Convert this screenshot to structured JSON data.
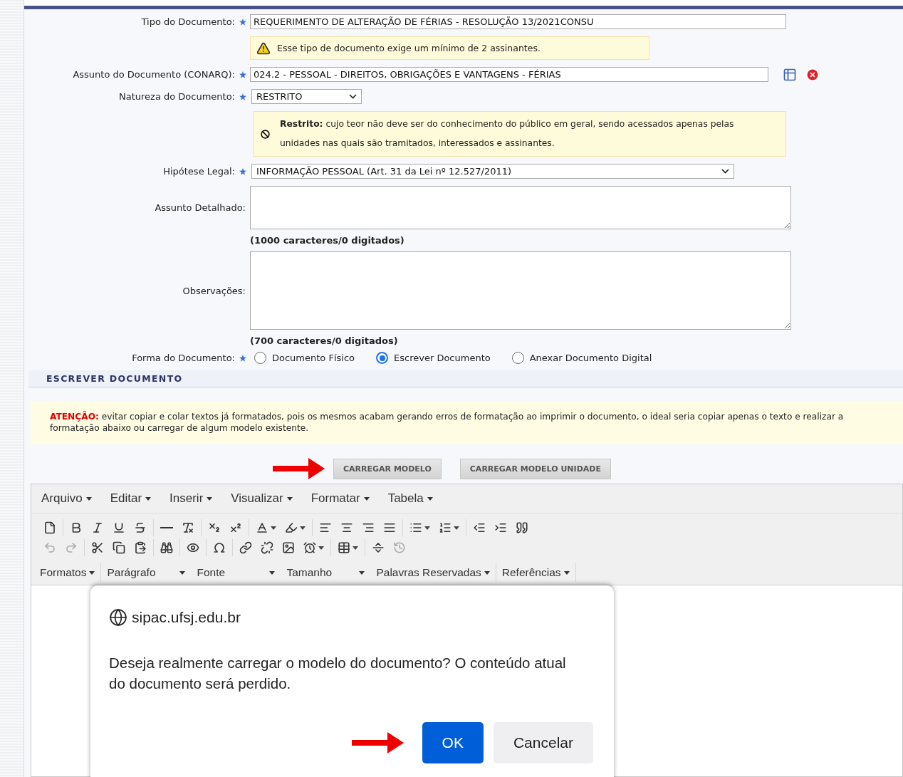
{
  "form": {
    "rows": [
      {
        "kind": "input",
        "label": "Tipo do Documento:",
        "required": true,
        "value": "REQUERIMENTO DE ALTERAÇÃO DE FÉRIAS - RESOLUÇÃO 13/2021CONSU"
      },
      {
        "kind": "warning",
        "text": "Esse tipo de documento exige um mínimo de 2 assinantes."
      },
      {
        "kind": "lookup",
        "label": "Assunto do Documento (CONARQ):",
        "required": true,
        "value": "024.2 - PESSOAL - DIREITOS, OBRIGAÇÕES E VANTAGENS - FÉRIAS"
      },
      {
        "kind": "select",
        "label": "Natureza do Documento:",
        "required": true,
        "value": "RESTRITO"
      },
      {
        "kind": "info",
        "text": "**Restrito:** cujo teor não deve ser do conhecimento do público em geral, sendo acessados apenas pelas unidades nas quais são tramitados, interessados e assinantes."
      },
      {
        "kind": "wide-select",
        "label": "Hipótese Legal:",
        "required": true,
        "value": "INFORMAÇÃO PESSOAL (Art. 31 da Lei nº 12.527/2011)"
      },
      {
        "kind": "short-textarea",
        "label": "Assunto Detalhado:",
        "required": false
      },
      {
        "kind": "counter",
        "text": "(1000 caracteres/0 digitados)"
      },
      {
        "kind": "long-textarea",
        "label": "Observações:",
        "required": false
      },
      {
        "kind": "counter",
        "text": "(700 caracteres/0 digitados)"
      },
      {
        "kind": "radios",
        "label": "Forma do Documento:",
        "required": true,
        "options": [
          {
            "label": "Documento Físico",
            "selected": false
          },
          {
            "label": "Escrever Documento",
            "selected": true
          },
          {
            "label": "Anexar Documento Digital",
            "selected": false
          }
        ]
      }
    ]
  },
  "section": {
    "title": "ESCREVER DOCUMENTO"
  },
  "attention": {
    "lead": "ATENÇÃO:",
    "text": "evitar copiar e colar textos já formatados, pois os mesmos acabam gerando erros de formatação ao imprimir o documento, o ideal seria copiar apenas o texto e realizar a formatação abaixo ou carregar de algum modelo existente."
  },
  "buttons": [
    {
      "label": "CARREGAR MODELO",
      "pointed": true
    },
    {
      "label": "CARREGAR MODELO UNIDADE",
      "pointed": false
    }
  ],
  "editor": {
    "menus": [
      "Arquivo",
      "Editar",
      "Inserir",
      "Visualizar",
      "Formatar",
      "Tabela"
    ],
    "dropdowns": [
      {
        "label": "Formatos",
        "kind": "menu"
      },
      {
        "label": "Parágrafo",
        "kind": "listbox"
      },
      {
        "label": "Fonte",
        "kind": "listbox"
      },
      {
        "label": "Tamanho",
        "kind": "listbox"
      },
      {
        "label": "Palavras Reservadas",
        "kind": "menu"
      },
      {
        "label": "Referências",
        "kind": "menu"
      }
    ]
  },
  "dialog": {
    "origin": "sipac.ufsj.edu.br",
    "message": "Deseja realmente carregar o modelo do documento? O conteúdo atual do documento será perdido.",
    "buttons": [
      {
        "label": "OK",
        "kind": "primary",
        "pointed": true
      },
      {
        "label": "Cancelar",
        "kind": "secondary",
        "pointed": false
      }
    ]
  }
}
